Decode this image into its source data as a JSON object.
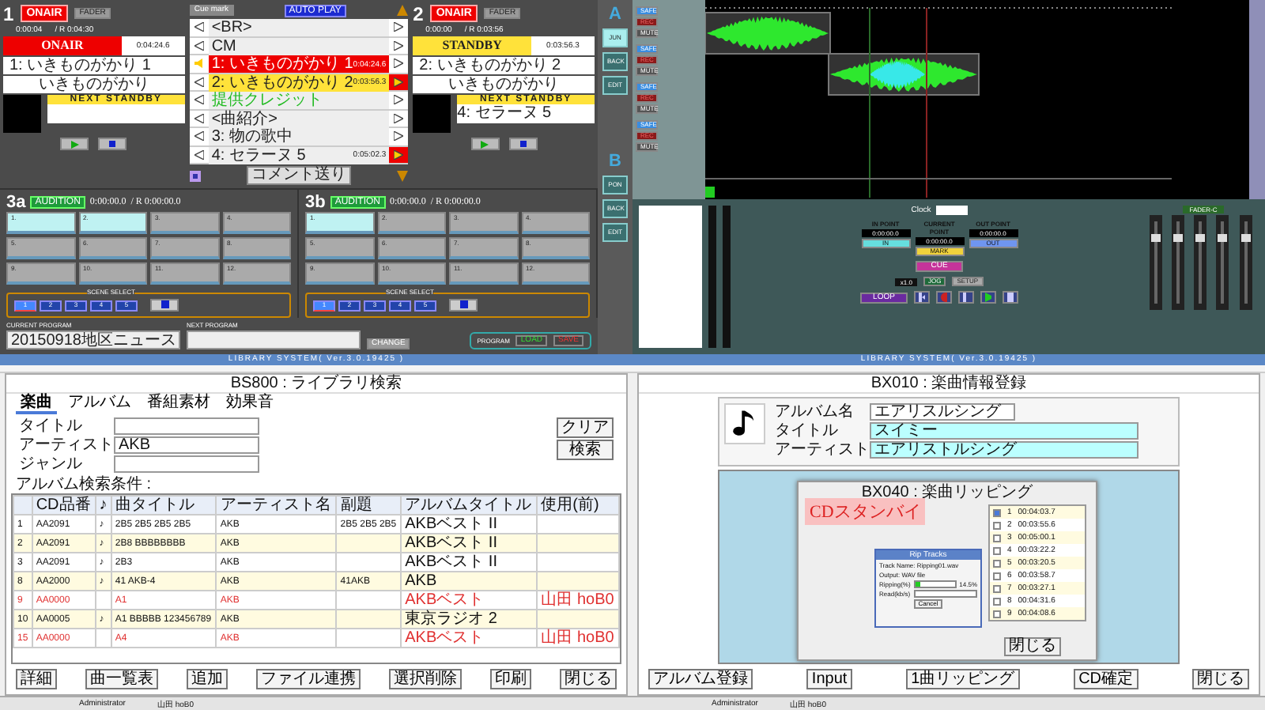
{
  "console": {
    "decks": [
      {
        "number": "1",
        "badge": "ONAIR",
        "fader": "FADER",
        "elapsed": "0:00:04",
        "remain": "/ R 0:04:30",
        "status": "ONAIR",
        "on_air": true,
        "status_time": "0:04:24.6",
        "title": "1: いきものがかり 1",
        "artist": "いきものがかり",
        "next_label": "NEXT STANDBY"
      },
      {
        "number": "2",
        "badge": "ONAIR",
        "fader": "FADER",
        "elapsed": "0:00:00",
        "remain": "/ R 0:03:56",
        "status": "STANDBY",
        "on_air": false,
        "status_time": "0:03:56.3",
        "title": "2: いきものがかり 2",
        "artist": "いきものがかり",
        "next_label": "NEXT STANDBY",
        "next": "4: セラーヌ 5"
      }
    ],
    "cue_mark": "Cue mark",
    "auto_play": "AUTO PLAY",
    "playlist": [
      {
        "text": "<BR>",
        "kind": "plain"
      },
      {
        "text": "CM",
        "kind": "plain"
      },
      {
        "text": "1: いきものがかり 1",
        "kind": "onair",
        "time": "0:04:24.6"
      },
      {
        "text": "2: いきものがかり 2",
        "kind": "standby",
        "time": "0:03:56.3"
      },
      {
        "text": "提供クレジット",
        "kind": "note"
      },
      {
        "text": "<曲紹介>",
        "kind": "plain"
      },
      {
        "text": "3: 物の歌中",
        "kind": "plain"
      },
      {
        "text": "4: セラーヌ 5",
        "kind": "next",
        "time": "0:05:02.3"
      }
    ],
    "comment_button": "コメント送り",
    "sides": [
      {
        "label": "A",
        "buttons": [
          "JUN",
          "BACK",
          "EDIT"
        ]
      },
      {
        "label": "B",
        "buttons": [
          "PON",
          "BACK",
          "EDIT"
        ]
      }
    ],
    "pads": [
      {
        "number": "3a",
        "audition": "AUDITION",
        "time": "0:00:00.0",
        "remain": "/ R 0:00:00.0",
        "scene_label": "SCENE SELECT",
        "cells": [
          {
            "label": "1.",
            "selected": true
          },
          {
            "label": "2.",
            "selected": true
          },
          {
            "label": "3.",
            "selected": false
          },
          {
            "label": "4.",
            "selected": false
          },
          {
            "label": "5.",
            "selected": false
          },
          {
            "label": "6.",
            "selected": false
          },
          {
            "label": "7.",
            "selected": false
          },
          {
            "label": "8.",
            "selected": false
          },
          {
            "label": "9.",
            "selected": false
          },
          {
            "label": "10.",
            "selected": false
          },
          {
            "label": "11.",
            "selected": false
          },
          {
            "label": "12.",
            "selected": false
          }
        ],
        "scenes": [
          {
            "label": "1",
            "selected": true
          },
          {
            "label": "2",
            "selected": false
          },
          {
            "label": "3",
            "selected": false
          },
          {
            "label": "4",
            "selected": false
          },
          {
            "label": "5",
            "selected": false
          }
        ]
      },
      {
        "number": "3b",
        "audition": "AUDITION",
        "time": "0:00:00.0",
        "remain": "/ R 0:00:00.0",
        "scene_label": "SCENE SELECT",
        "cells": [
          {
            "label": "1.",
            "selected": true
          },
          {
            "label": "2.",
            "selected": false
          },
          {
            "label": "3.",
            "selected": false
          },
          {
            "label": "4.",
            "selected": false
          },
          {
            "label": "5.",
            "selected": false
          },
          {
            "label": "6.",
            "selected": false
          },
          {
            "label": "7.",
            "selected": false
          },
          {
            "label": "8.",
            "selected": false
          },
          {
            "label": "9.",
            "selected": false
          },
          {
            "label": "10.",
            "selected": false
          },
          {
            "label": "11.",
            "selected": false
          },
          {
            "label": "12.",
            "selected": false
          }
        ],
        "scenes": [
          {
            "label": "1",
            "selected": true
          },
          {
            "label": "2",
            "selected": false
          },
          {
            "label": "3",
            "selected": false
          },
          {
            "label": "4",
            "selected": false
          },
          {
            "label": "5",
            "selected": false
          }
        ]
      }
    ],
    "program": {
      "current_label": "CURRENT PROGRAM",
      "current": "20150918地区ニュース",
      "next_label": "NEXT PROGRAM",
      "change": "CHANGE",
      "program_label": "PROGRAM",
      "load": "LOAD",
      "save": "SAVE"
    }
  },
  "editor": {
    "tracks": [
      {
        "safe": "SAFE",
        "rec": "REC",
        "mute": "MUTE"
      },
      {
        "safe": "SAFE",
        "rec": "REC",
        "mute": "MUTE"
      },
      {
        "safe": "SAFE",
        "rec": "REC",
        "mute": "MUTE"
      },
      {
        "safe": "SAFE",
        "rec": "REC",
        "mute": "MUTE"
      }
    ],
    "clock_label": "Clock",
    "points": [
      {
        "label": "IN POINT",
        "value": "0:00:00.0",
        "button": "IN",
        "color": "#66dede"
      },
      {
        "label": "CURRENT POINT",
        "value": "0:00:00.0",
        "button": "MARK",
        "color": "#f0d23c"
      },
      {
        "label": "OUT POINT",
        "value": "0:00:00.0",
        "button": "OUT",
        "color": "#6f95f0"
      }
    ],
    "cue": "CUE",
    "speed": "x1.0",
    "jog": "JOG",
    "setup": "SETUP",
    "loop": "LOOP",
    "fader": "FADER-C"
  },
  "search": {
    "window_title": "LIBRARY SYSTEM( Ver.3.0.19425 )",
    "screen_title": "BS800 : ライブラリ検索",
    "tabs": [
      {
        "label": "楽曲",
        "selected": true
      },
      {
        "label": "アルバム",
        "selected": false
      },
      {
        "label": "番組素材",
        "selected": false
      },
      {
        "label": "効果音",
        "selected": false
      }
    ],
    "fields": [
      {
        "label": "タイトル"
      },
      {
        "label": "アーティスト",
        "value": "AKB"
      },
      {
        "label": "ジャンル"
      }
    ],
    "clear": "クリア",
    "search": "検索",
    "condition": "アルバム検索条件 :",
    "columns": [
      "CD品番",
      "♪",
      "曲タイトル",
      "アーティスト名",
      "副題",
      "アルバムタイトル",
      "使用(前)"
    ],
    "rows": [
      {
        "no": "1",
        "cd": "AA2091",
        "note": "♪",
        "title": "2B5 2B5 2B5 2B5",
        "artist": "AKB",
        "subtitle": "2B5 2B5 2B5",
        "album": "AKBベスト II",
        "reserved": false
      },
      {
        "no": "2",
        "cd": "AA2091",
        "note": "♪",
        "title": "2B8 BBBBBBBB",
        "artist": "AKB",
        "album": "AKBベスト II",
        "reserved": false
      },
      {
        "no": "3",
        "cd": "AA2091",
        "note": "♪",
        "title": "2B3",
        "artist": "AKB",
        "album": "AKBベスト II",
        "reserved": false
      },
      {
        "no": "8",
        "cd": "AA2000",
        "note": "♪",
        "title": "41 AKB-4",
        "artist": "AKB",
        "subtitle": "41AKB",
        "album": "AKB",
        "reserved": false
      },
      {
        "no": "9",
        "cd": "AA0000",
        "title": "A1",
        "artist": "AKB",
        "album": "AKBベスト",
        "used": "山田 hoB0",
        "reserved": true
      },
      {
        "no": "10",
        "cd": "AA0005",
        "note": "♪",
        "title": "A1 BBBBB 123456789",
        "artist": "AKB",
        "album": "東京ラジオ 2",
        "reserved": false
      },
      {
        "no": "15",
        "cd": "AA0000",
        "title": "A4",
        "artist": "AKB",
        "album": "AKBベスト",
        "used": "山田 hoB0",
        "reserved": true
      }
    ],
    "buttons": [
      "詳細",
      "曲一覧表",
      "追加",
      "ファイル連携",
      "選択削除",
      "印刷",
      "閉じる"
    ],
    "status": [
      "Administrator",
      "山田 hoB0"
    ]
  },
  "register": {
    "window_title": "LIBRARY SYSTEM( Ver.3.0.19425 )",
    "screen_title": "BX010 : 楽曲情報登録",
    "album_label": "アルバム名",
    "album": "エアリスルシング",
    "fields": [
      {
        "label": "タイトル",
        "value": "スイミー"
      },
      {
        "label": "アーティスト",
        "value": "エアリストルシング"
      }
    ],
    "dialog_title": "BX040 : 楽曲リッピング",
    "standby": "CDスタンバイ",
    "rip": {
      "title": "Rip Tracks",
      "track": "Track Name: Ripping01.wav",
      "output": "Output: WAV file",
      "ripping_label": "Ripping(%)",
      "level": 0.12,
      "reading": "14.5%",
      "read_label": "Read(kb/s)",
      "cancel": "Cancel"
    },
    "tracks": [
      {
        "no": "1",
        "time": "00:04:03.7",
        "checked": true
      },
      {
        "no": "2",
        "time": "00:03:55.6",
        "checked": false
      },
      {
        "no": "3",
        "time": "00:05:00.1",
        "checked": false
      },
      {
        "no": "4",
        "time": "00:03:22.2",
        "checked": false
      },
      {
        "no": "5",
        "time": "00:03:20.5",
        "checked": false
      },
      {
        "no": "6",
        "time": "00:03:58.7",
        "checked": false
      },
      {
        "no": "7",
        "time": "00:03:27.1",
        "checked": false
      },
      {
        "no": "8",
        "time": "00:04:31.6",
        "checked": false
      },
      {
        "no": "9",
        "time": "00:04:08.6",
        "checked": false
      }
    ],
    "dialog_close": "閉じる",
    "buttons": [
      "アルバム登録",
      "Input",
      "1曲リッピング",
      "CD確定",
      "閉じる"
    ],
    "status": [
      "Administrator",
      "山田 hoB0"
    ]
  }
}
